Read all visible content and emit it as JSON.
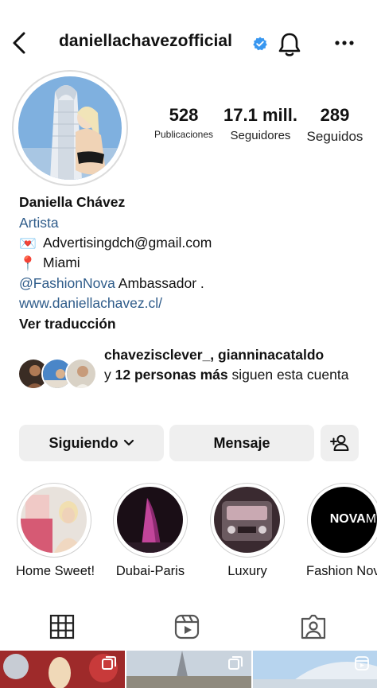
{
  "header": {
    "username": "daniellachavezofficial",
    "icons": [
      "back-arrow-icon",
      "verified-badge-icon",
      "notification-bell-icon",
      "more-options-icon"
    ],
    "verified_color": "#3897f0"
  },
  "stats": {
    "posts": {
      "value": "528",
      "label": "Publicaciones"
    },
    "followers": {
      "value": "17.1 mill.",
      "label": "Seguidores"
    },
    "following": {
      "value": "289",
      "label": "Seguidos"
    }
  },
  "bio": {
    "name": "Daniella Chávez",
    "category": "Artista",
    "email_emoji": "💌",
    "email": "Advertisingdch@gmail.com",
    "location_emoji": "📍",
    "location": "Miami",
    "mention": "@FashionNova",
    "mention_suffix": " Ambassador .",
    "link": "www.daniellachavez.cl/",
    "translate": "Ver traducción",
    "link_color": "#2f5c8a"
  },
  "followed_by": {
    "names": "chavezisclever_, gianninacataldo",
    "prefix": "y ",
    "others": "12 personas más",
    "suffix": " siguen esta cuenta"
  },
  "buttons": {
    "following": "Siguiendo",
    "message": "Mensaje",
    "add_user_icon": "add-user-icon"
  },
  "highlights": [
    {
      "label": "Home Sweet!"
    },
    {
      "label": "Dubai-Paris"
    },
    {
      "label": "Luxury"
    },
    {
      "label": "Fashion Nov",
      "logo_text": "NOVA",
      "logo_text_2": "MEN"
    }
  ],
  "tabs": [
    "grid-icon",
    "reels-icon",
    "tagged-icon"
  ]
}
